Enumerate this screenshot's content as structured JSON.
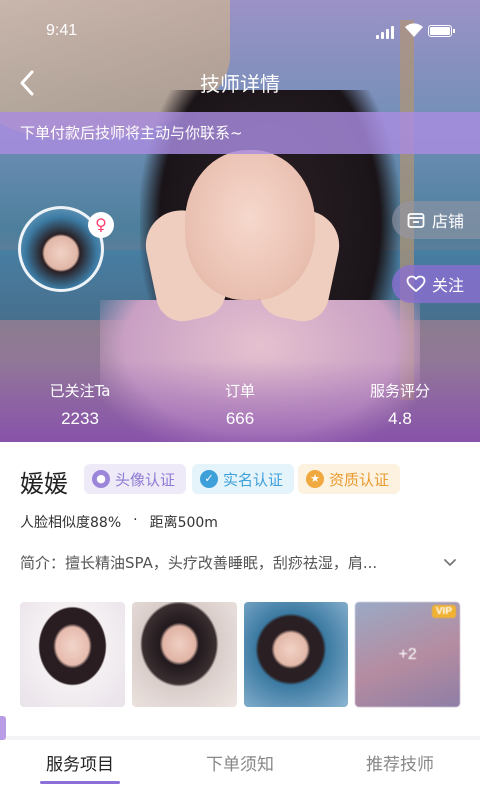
{
  "status_bar": {
    "time": "9:41"
  },
  "header": {
    "title": "技师详情"
  },
  "notice": "下单付款后技师将主动与你联系~",
  "side_buttons": {
    "store": "店铺",
    "follow": "关注"
  },
  "stats": [
    {
      "label": "已关注Ta",
      "value": "2233"
    },
    {
      "label": "订单",
      "value": "666"
    },
    {
      "label": "服务评分",
      "value": "4.8"
    }
  ],
  "profile": {
    "name": "媛媛",
    "badges": [
      "头像认证",
      "实名认证",
      "资质认证"
    ],
    "similarity": "人脸相似度88%",
    "separator": "·",
    "distance": "距离500m",
    "intro": "简介：擅长精油SPA，头疗改善睡眠，刮痧祛湿，肩..."
  },
  "gallery": {
    "more_count": "+2",
    "vip_label": "VIP"
  },
  "tabs": [
    "服务项目",
    "下单须知",
    "推荐技师"
  ],
  "colors": {
    "accent": "#8c6fd8",
    "notice_bg": "#aa8ce1",
    "badge_avatar": "#9b86da",
    "badge_realname": "#3ea0d9",
    "badge_qualification": "#f0a93e"
  }
}
